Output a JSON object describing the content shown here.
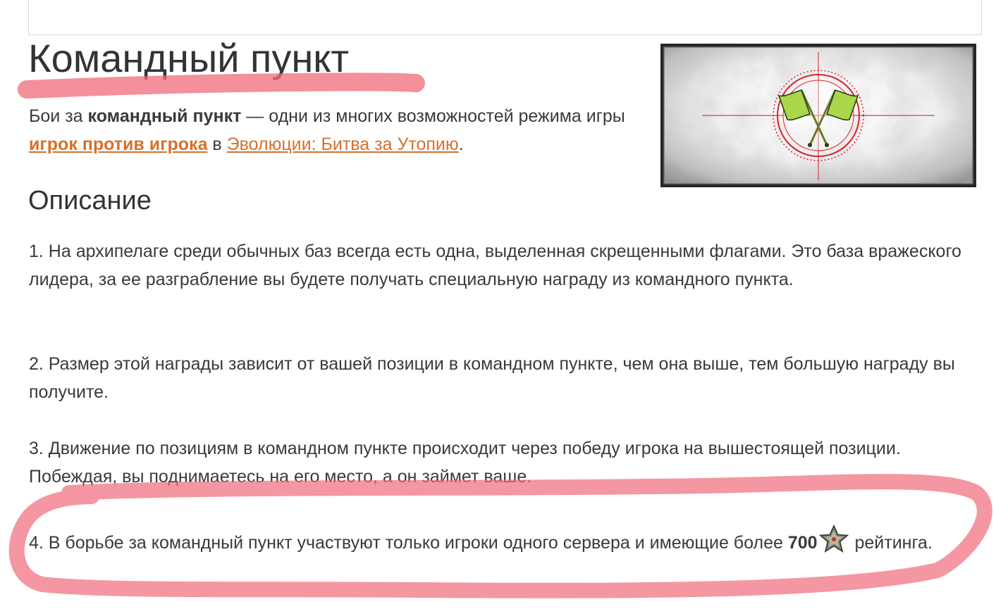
{
  "page": {
    "title": "Командный пункт"
  },
  "intro": {
    "pre": "Бои за ",
    "bold_term": "командный пункт",
    "mid": " — одни из многих возможностей режима игры ",
    "link_pvp": "игрок против игрока",
    "between": " в ",
    "link_game": "Эволюции: Битва за Утопию",
    "end": "."
  },
  "section": {
    "heading": "Описание"
  },
  "items": {
    "p1": "1. На архипелаге среди обычных баз всегда есть одна, выделенная скрещенными флагами. Это база вражеского лидера, за ее разграбление вы будете получать специальную награду из командного пункта.",
    "p2": "2. Размер этой награды зависит от вашей позиции в командном пункте, чем она выше, тем большую награду вы получите.",
    "p3": "3. Движение по позициям в командном пункте происходит через победу игрока на вышестоящей позиции. Побеждая, вы поднимаетесь на его место, а он займет ваше.",
    "p4_pre": "4. В борьбе за командный пункт участвуют только игроки одного сервера и имеющие более ",
    "p4_bold": "700",
    "p4_post": " рейтинга."
  },
  "icons": {
    "image": "crossed-green-flags-target-icon",
    "rating": "rating-star-icon"
  },
  "colors": {
    "link": "#d5712c",
    "highlight": "#ef6b7a",
    "flag_green": "#a8d84a",
    "target_red": "#d9222a"
  }
}
